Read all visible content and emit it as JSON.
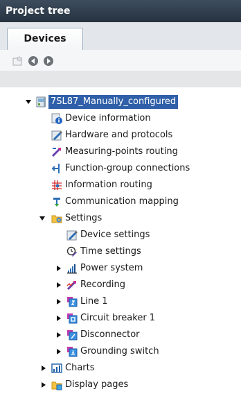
{
  "panel": {
    "title": "Project tree"
  },
  "tabs": [
    {
      "label": "Devices"
    }
  ],
  "toolbar": [
    {
      "icon": "new-folder-icon"
    },
    {
      "icon": "back-arrow-icon"
    },
    {
      "icon": "forward-arrow-icon"
    }
  ],
  "tree": {
    "root": {
      "label": "7SL87_Manually_configured",
      "icon": "device-icon",
      "expanded": true,
      "selected": true
    },
    "items": [
      {
        "label": "Device information",
        "icon": "info-icon"
      },
      {
        "label": "Hardware and protocols",
        "icon": "hardware-icon"
      },
      {
        "label": "Measuring-points routing",
        "icon": "routing-icon"
      },
      {
        "label": "Function-group connections",
        "icon": "connection-icon"
      },
      {
        "label": "Information routing",
        "icon": "matrix-icon"
      },
      {
        "label": "Communication mapping",
        "icon": "mapping-icon"
      },
      {
        "label": "Settings",
        "icon": "settings-folder-icon",
        "expanded": true
      },
      {
        "label": "Device settings",
        "icon": "device-settings-icon"
      },
      {
        "label": "Time settings",
        "icon": "time-settings-icon"
      },
      {
        "label": "Power system",
        "icon": "power-system-icon",
        "collapsed": true
      },
      {
        "label": "Recording",
        "icon": "recording-icon",
        "collapsed": true
      },
      {
        "label": "Line 1",
        "icon": "function-group-icon",
        "collapsed": true
      },
      {
        "label": "Circuit breaker 1",
        "icon": "function-group-icon",
        "collapsed": true
      },
      {
        "label": "Disconnector",
        "icon": "function-group-icon",
        "collapsed": true
      },
      {
        "label": "Grounding switch",
        "icon": "function-group-icon",
        "collapsed": true
      },
      {
        "label": "Charts",
        "icon": "charts-icon",
        "collapsed": true
      },
      {
        "label": "Display pages",
        "icon": "display-pages-icon",
        "collapsed": true
      }
    ]
  }
}
